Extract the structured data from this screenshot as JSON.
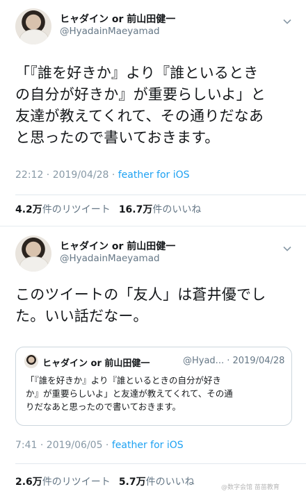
{
  "tweet1": {
    "name": "ヒャダイン or 前山田健一",
    "handle": "@HyadainMaeyamad",
    "text_lines": [
      "「『誰を好きか』より『誰といるとき",
      "の自分が好きか』が重要らしいよ」と",
      "友達が教えてくれて、その通りだなあ",
      "と思ったので書いておきます。"
    ],
    "time": "22:12 · 2019/04/28 · ",
    "source": "feather for iOS",
    "retweets_count": "4.2万",
    "retweets_label": "件のリツイート",
    "likes_count": "16.7万",
    "likes_label": "件のいいね"
  },
  "tweet2": {
    "name": "ヒャダイン or 前山田健一",
    "handle": "@HyadainMaeyamad",
    "text_lines": [
      "このツイートの「友人」は蒼井優でし",
      "た。いい話だなー。"
    ],
    "quote": {
      "name": "ヒャダイン or 前山田健一",
      "handle": "@Hyad... · 2019/04/28",
      "text_lines": [
        "「『誰を好きか』より『誰といるときの自分が好き",
        "か』が重要らしいよ」と友達が教えてくれて、その通",
        "りだなあと思ったので書いておきます。"
      ]
    },
    "time": "7:41 · 2019/06/05 · ",
    "source": "feather for iOS",
    "retweets_count": "2.6万",
    "retweets_label": "件のリツイート",
    "likes_count": "5.7万",
    "likes_label": "件のいいね"
  },
  "watermark": "@数字会馆 苗苗教育",
  "icons": {
    "menu": "chevron-down-icon",
    "avatar": "profile-photo"
  },
  "colors": {
    "text": "#14171a",
    "muted": "#8899a6",
    "link": "#1da1f2",
    "border": "#ccd6dd"
  }
}
